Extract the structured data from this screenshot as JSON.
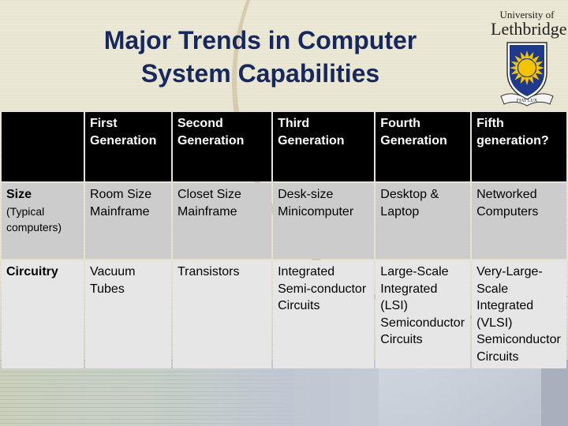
{
  "slide": {
    "title_line1": "Major Trends in Computer",
    "title_line2": "System Capabilities"
  },
  "logo": {
    "line1": "University of",
    "line2": "Lethbridge",
    "motto": "FIAT LUX",
    "colors": {
      "shield": "#1f3a8a",
      "sun": "#f5c400",
      "text": "#222222"
    }
  },
  "table": {
    "columns": [
      "",
      "First Generation",
      "Second Generation",
      "Third Generation",
      "Fourth Generation",
      "Fifth generation?"
    ],
    "rows": [
      {
        "header": "Size",
        "subheader": "(Typical computers)",
        "cells": [
          "Room Size Mainframe",
          "Closet Size Mainframe",
          "Desk-size Minicomputer",
          "Desktop & Laptop",
          "Networked Computers"
        ]
      },
      {
        "header": "Circuitry",
        "subheader": "",
        "cells": [
          "Vacuum Tubes",
          "Transistors",
          "Integrated Semi-conductor Circuits",
          "Large-Scale Integrated (LSI) Semiconductor Circuits",
          "Very-Large-Scale Integrated (VLSI) Semiconductor Circuits"
        ]
      }
    ]
  },
  "colors": {
    "title": "#17285e",
    "header_bg": "#000000",
    "row1_bg": "#cccccc",
    "row2_bg": "#e6e6e6"
  }
}
